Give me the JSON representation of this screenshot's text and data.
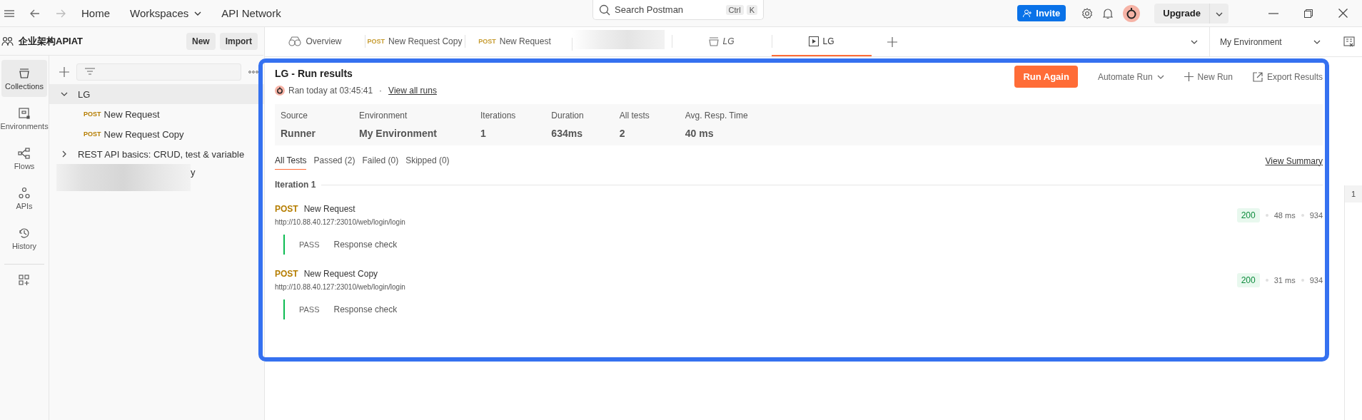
{
  "topbar": {
    "nav": [
      {
        "label": "Home",
        "dropdown": false
      },
      {
        "label": "Workspaces",
        "dropdown": true
      },
      {
        "label": "API Network",
        "dropdown": false
      }
    ],
    "search": {
      "placeholder": "Search Postman",
      "keys": [
        "Ctrl",
        "K"
      ]
    },
    "invite": "Invite",
    "upgrade": "Upgrade"
  },
  "workspace": {
    "name": "企业架构APIAT",
    "buttons": [
      "New",
      "Import"
    ]
  },
  "rail": [
    {
      "kind": "collections",
      "label": "Collections",
      "selected": true
    },
    {
      "kind": "environments",
      "label": "Environments",
      "selected": false
    },
    {
      "kind": "flows",
      "label": "Flows",
      "selected": false
    },
    {
      "kind": "apis",
      "label": "APIs",
      "selected": false
    },
    {
      "kind": "history",
      "label": "History",
      "selected": false
    }
  ],
  "tree": [
    {
      "label": "LG",
      "expanded": true,
      "selected": true,
      "children": [
        {
          "method": "POST",
          "label": "New Request",
          "selected": false
        },
        {
          "method": "POST",
          "label": "New Request Copy",
          "selected": false
        }
      ]
    },
    {
      "label": "REST API basics: CRUD, test & variable",
      "expanded": false,
      "selected": false
    },
    {
      "label": "y",
      "blurred": true,
      "selected": false
    }
  ],
  "tabs": [
    {
      "kind": "overview",
      "label": "Overview",
      "selected": false
    },
    {
      "kind": "request",
      "method": "POST",
      "label": "New Request Copy",
      "selected": false
    },
    {
      "kind": "request",
      "method": "POST",
      "label": "New Request",
      "selected": false
    },
    {
      "kind": "blurred",
      "selected": false
    },
    {
      "kind": "collection",
      "label": "LG",
      "selected": false
    },
    {
      "kind": "runner",
      "label": "LG",
      "selected": true
    }
  ],
  "environment": "My Environment",
  "run": {
    "title": "LG - Run results",
    "ran": "Ran today at 03:45:41",
    "separator": "·",
    "view_all": "View all runs",
    "run_again": "Run Again",
    "automate": "Automate Run",
    "new_run": "New Run",
    "export": "Export Results"
  },
  "stats": [
    {
      "label": "Source",
      "value": "Runner"
    },
    {
      "label": "Environment",
      "value": "My Environment"
    },
    {
      "label": "Iterations",
      "value": "1"
    },
    {
      "label": "Duration",
      "value": "634ms"
    },
    {
      "label": "All tests",
      "value": "2"
    },
    {
      "label": "Avg. Resp. Time",
      "value": "40 ms"
    }
  ],
  "filters": [
    {
      "label": "All Tests",
      "selected": true
    },
    {
      "label": "Passed (2)",
      "selected": false
    },
    {
      "label": "Failed (0)",
      "selected": false
    },
    {
      "label": "Skipped (0)",
      "selected": false
    }
  ],
  "view_summary": "View Summary",
  "iteration": "Iteration 1",
  "requests": [
    {
      "method": "POST",
      "name": "New Request",
      "url": "http://10.88.40.127:23010/web/login/login",
      "status": "200",
      "time": "48 ms",
      "size": "934",
      "tests": [
        {
          "result": "PASS",
          "passed": true,
          "name": "Response check"
        }
      ]
    },
    {
      "method": "POST",
      "name": "New Request Copy",
      "url": "http://10.88.40.127:23010/web/login/login",
      "status": "200",
      "time": "31 ms",
      "size": "934",
      "tests": [
        {
          "result": "PASS",
          "passed": true,
          "name": "Response check"
        }
      ]
    }
  ],
  "gutter": "1"
}
